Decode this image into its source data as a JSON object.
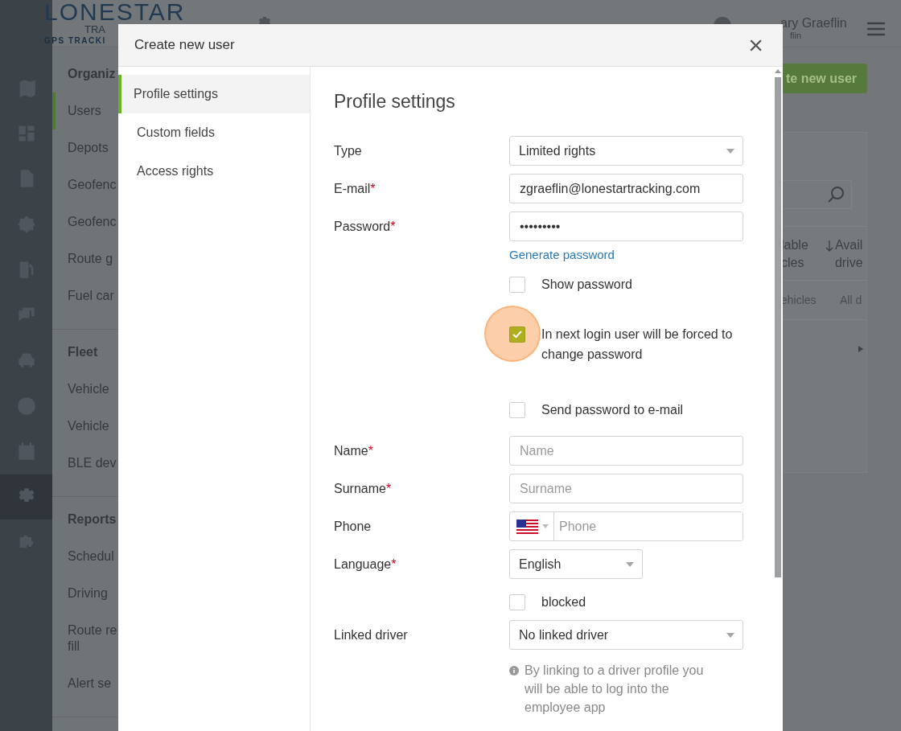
{
  "header": {
    "logo": {
      "name": "LONESTAR",
      "sub": "TRA",
      "tagline": "GPS TRACKI"
    },
    "user": {
      "name": "ary Graeflin",
      "login": "flin"
    }
  },
  "rail": [
    {
      "selected": false
    },
    {
      "selected": false
    },
    {
      "selected": false
    },
    {
      "selected": false
    },
    {
      "selected": false
    },
    {
      "selected": false
    },
    {
      "selected": false
    },
    {
      "selected": false
    },
    {
      "selected": false
    },
    {
      "selected": true
    },
    {
      "selected": false
    }
  ],
  "nav": [
    {
      "title": "Organiz",
      "items": [
        {
          "label": "Users",
          "selected": true
        },
        {
          "label": "Depots",
          "selected": false
        },
        {
          "label": "Geofenc",
          "selected": false
        },
        {
          "label": "Geofenc",
          "selected": false
        },
        {
          "label": "Route g",
          "selected": false
        },
        {
          "label": "Fuel car",
          "selected": false
        }
      ]
    },
    {
      "title": "Fleet",
      "items": [
        {
          "label": "Vehicle",
          "selected": false
        },
        {
          "label": "Vehicle",
          "selected": false
        },
        {
          "label": "BLE dev",
          "selected": false
        }
      ]
    },
    {
      "title": "Reports",
      "items": [
        {
          "label": "Schedul",
          "selected": false
        },
        {
          "label": "Driving",
          "selected": false
        },
        {
          "label": "Route re fill",
          "selected": false
        },
        {
          "label": "Alert se",
          "selected": false
        }
      ]
    }
  ],
  "main": {
    "button": "te new user",
    "table": {
      "columns": [
        "lable cles",
        "Avail drive"
      ],
      "row": [
        "ehicles",
        "All d"
      ]
    }
  },
  "modal": {
    "title": "Create new user",
    "close": "×",
    "required_mark": "*",
    "tabs": [
      {
        "label": "Profile settings",
        "selected": true
      },
      {
        "label": "Custom fields",
        "selected": false
      },
      {
        "label": "Access rights",
        "selected": false
      }
    ],
    "heading": "Profile settings",
    "fields": [
      {
        "kind": "select",
        "label": "Type",
        "required": false,
        "value": "Limited rights",
        "compact": false
      },
      {
        "kind": "input",
        "label": "E-mail",
        "required": true,
        "value": "zgraeflin@lonestartracking.com"
      },
      {
        "kind": "input",
        "label": "Password",
        "required": true,
        "value": "•••••••••"
      },
      {
        "kind": "link",
        "text": "Generate password"
      },
      {
        "kind": "checkbox",
        "text": "Show password",
        "checked": false,
        "highlighted": false
      },
      {
        "kind": "checkbox",
        "text": "In next login user will be forced to change password",
        "checked": true,
        "highlighted": true
      },
      {
        "kind": "checkbox",
        "text": "Send password to e-mail",
        "checked": false,
        "highlighted": false
      },
      {
        "kind": "input",
        "label": "Name",
        "required": true,
        "placeholder": "Name"
      },
      {
        "kind": "input",
        "label": "Surname",
        "required": true,
        "placeholder": "Surname"
      },
      {
        "kind": "phone",
        "label": "Phone",
        "required": false,
        "placeholder": "Phone"
      },
      {
        "kind": "select",
        "label": "Language",
        "required": true,
        "value": "English",
        "compact": true
      },
      {
        "kind": "checkbox",
        "text": "blocked",
        "checked": false,
        "highlighted": false
      },
      {
        "kind": "select",
        "label": "Linked driver",
        "required": false,
        "value": "No linked driver",
        "compact": false
      },
      {
        "kind": "note",
        "text": "By linking to a driver profile you will be able to log into the employee app"
      }
    ]
  }
}
